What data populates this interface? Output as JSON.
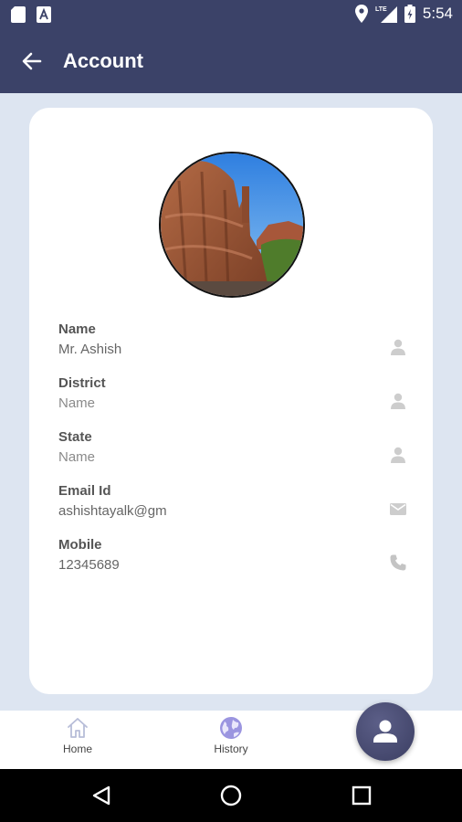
{
  "status_bar": {
    "time": "5:54",
    "network": "LTE",
    "left_icons": [
      "sd-card-icon",
      "app-notification-icon"
    ],
    "right_icons": [
      "location-icon",
      "signal-icon",
      "battery-icon"
    ]
  },
  "app_bar": {
    "title": "Account",
    "back_icon": "arrow-left-icon",
    "background": "#3b4268"
  },
  "profile": {
    "fields": [
      {
        "label": "Name",
        "value": "Mr. Ashish",
        "icon": "person-icon"
      },
      {
        "label": "District",
        "value": "Name",
        "icon": "person-icon"
      },
      {
        "label": "State",
        "value": "Name",
        "icon": "person-icon"
      },
      {
        "label": "Email Id",
        "value": "ashishtayalk@gm",
        "icon": "mail-icon"
      },
      {
        "label": "Mobile",
        "value": "12345689",
        "icon": "phone-icon"
      }
    ]
  },
  "bottom_nav": {
    "items": [
      {
        "label": "Home",
        "icon": "home-icon"
      },
      {
        "label": "History",
        "icon": "globe-icon"
      }
    ],
    "fab_icon": "person-icon",
    "fab_color": "#474a72"
  },
  "colors": {
    "accent": "#3b4268",
    "page_background": "#dde5f1",
    "card": "#ffffff",
    "history_icon": "#9b95e0"
  }
}
